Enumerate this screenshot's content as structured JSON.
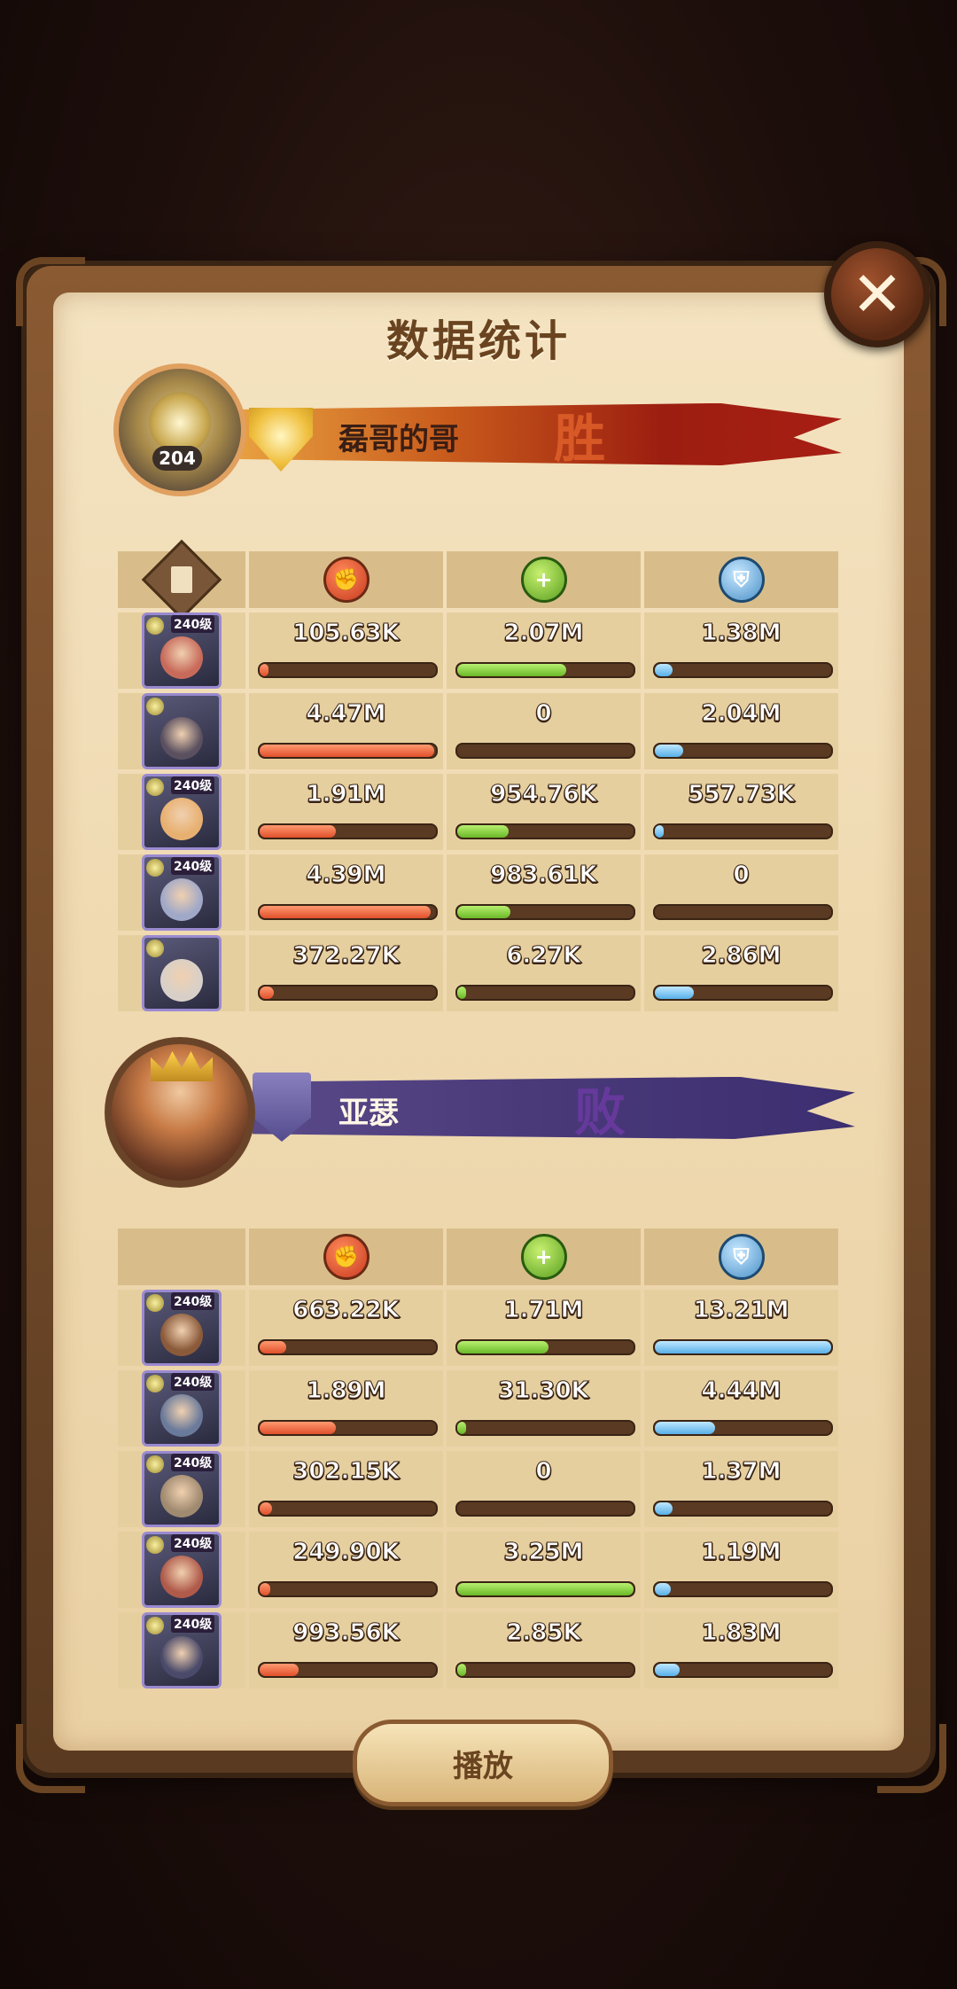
{
  "title": "数据统计",
  "close_icon_glyph": "✕",
  "team1": {
    "name": "磊哥的哥",
    "result": "胜",
    "level": "204",
    "heroes": [
      {
        "level": "240级",
        "damage": "105.63K",
        "dmg_frac": 0.02,
        "heal": "2.07M",
        "heal_frac": 0.62,
        "shield": "1.38M",
        "shield_frac": 0.1
      },
      {
        "level": "",
        "damage": "4.47M",
        "dmg_frac": 0.99,
        "heal": "0",
        "heal_frac": 0.0,
        "shield": "2.04M",
        "shield_frac": 0.16
      },
      {
        "level": "240级",
        "damage": "1.91M",
        "dmg_frac": 0.43,
        "heal": "954.76K",
        "heal_frac": 0.29,
        "shield": "557.73K",
        "shield_frac": 0.04
      },
      {
        "level": "240级",
        "damage": "4.39M",
        "dmg_frac": 0.97,
        "heal": "983.61K",
        "heal_frac": 0.3,
        "shield": "0",
        "shield_frac": 0.0
      },
      {
        "level": "",
        "damage": "372.27K",
        "dmg_frac": 0.08,
        "heal": "6.27K",
        "heal_frac": 0.01,
        "shield": "2.86M",
        "shield_frac": 0.22
      }
    ]
  },
  "team2": {
    "name": "亚瑟",
    "result": "败",
    "heroes": [
      {
        "level": "240级",
        "damage": "663.22K",
        "dmg_frac": 0.15,
        "heal": "1.71M",
        "heal_frac": 0.52,
        "shield": "13.21M",
        "shield_frac": 1.0
      },
      {
        "level": "240级",
        "damage": "1.89M",
        "dmg_frac": 0.43,
        "heal": "31.30K",
        "heal_frac": 0.01,
        "shield": "4.44M",
        "shield_frac": 0.34
      },
      {
        "level": "240级",
        "damage": "302.15K",
        "dmg_frac": 0.07,
        "heal": "0",
        "heal_frac": 0.0,
        "shield": "1.37M",
        "shield_frac": 0.1
      },
      {
        "level": "240级",
        "damage": "249.90K",
        "dmg_frac": 0.06,
        "heal": "3.25M",
        "heal_frac": 1.0,
        "shield": "1.19M",
        "shield_frac": 0.09
      },
      {
        "level": "240级",
        "damage": "993.56K",
        "dmg_frac": 0.22,
        "heal": "2.85K",
        "heal_frac": 0.01,
        "shield": "1.83M",
        "shield_frac": 0.14
      }
    ]
  },
  "columns": [
    {
      "icon": "damage-icon"
    },
    {
      "icon": "heal-icon"
    },
    {
      "icon": "shield-icon"
    }
  ],
  "play_button": "播放",
  "colors": {
    "damage": "#e0502c",
    "heal": "#6ab828",
    "shield": "#58b0e8",
    "win_banner": "#9c1e10",
    "lose_banner": "#3c2e70"
  }
}
